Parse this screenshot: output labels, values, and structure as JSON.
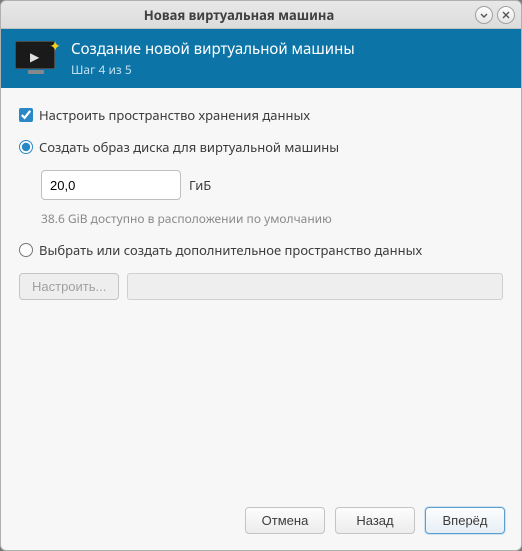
{
  "window": {
    "title": "Новая виртуальная машина"
  },
  "header": {
    "title": "Создание новой виртуальной машины",
    "step": "Шаг 4 из 5"
  },
  "storage": {
    "enable_label": "Настроить пространство хранения данных",
    "enable_checked": true,
    "create_image": {
      "label": "Создать образ диска для виртуальной машины",
      "selected": true,
      "size_value": "20,0",
      "unit": "ГиБ",
      "available_hint": "38.6 GiB доступно в расположении по умолчанию"
    },
    "custom": {
      "label": "Выбрать или создать дополнительное пространство данных",
      "selected": false,
      "configure_btn": "Настроить...",
      "path_value": ""
    }
  },
  "buttons": {
    "cancel": "Отмена",
    "back": "Назад",
    "forward": "Вперёд"
  }
}
